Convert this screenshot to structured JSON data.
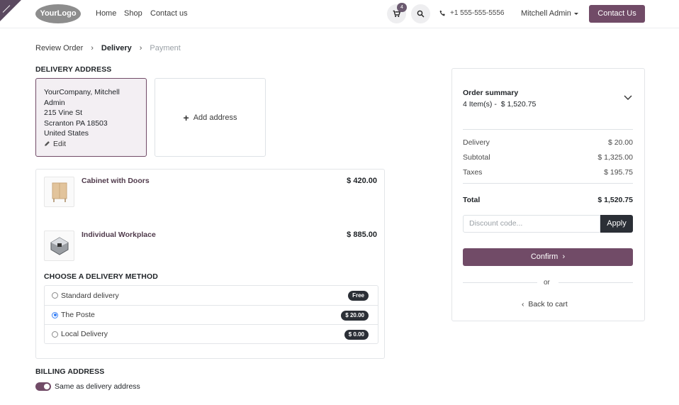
{
  "header": {
    "logo_text": "YourLogo",
    "nav": [
      "Home",
      "Shop",
      "Contact us"
    ],
    "cart_count": "4",
    "phone": "+1 555-555-5556",
    "user": "Mitchell Admin",
    "contact_button": "Contact Us"
  },
  "breadcrumb": [
    "Review Order",
    "Delivery",
    "Payment"
  ],
  "delivery_address": {
    "title": "DELIVERY ADDRESS",
    "name": "YourCompany, Mitchell Admin",
    "street": "215 Vine St",
    "city": "Scranton PA 18503",
    "country": "United States",
    "edit_label": "Edit",
    "add_label": "Add address"
  },
  "products": [
    {
      "name": "Cabinet with Doors",
      "price": "$ 420.00"
    },
    {
      "name": "Individual Workplace",
      "price": "$ 885.00"
    }
  ],
  "delivery_method": {
    "title": "CHOOSE A DELIVERY METHOD",
    "options": [
      {
        "label": "Standard delivery",
        "price": "Free",
        "selected": false
      },
      {
        "label": "The Poste",
        "price": "$ 20.00",
        "selected": true
      },
      {
        "label": "Local Delivery",
        "price": "$ 0.00",
        "selected": false
      }
    ]
  },
  "billing": {
    "title": "BILLING ADDRESS",
    "same_label": "Same as delivery address",
    "same_checked": true
  },
  "summary": {
    "title": "Order summary",
    "items": "4 Item(s) -",
    "items_total": "$ 1,520.75",
    "rows": [
      {
        "label": "Delivery",
        "value": "$ 20.00"
      },
      {
        "label": "Subtotal",
        "value": "$ 1,325.00"
      },
      {
        "label": "Taxes",
        "value": "$ 195.75"
      }
    ],
    "total_label": "Total",
    "total_value": "$ 1,520.75",
    "discount_placeholder": "Discount code...",
    "apply_label": "Apply",
    "confirm_label": "Confirm",
    "or_label": "or",
    "back_label": "Back to cart"
  },
  "colors": {
    "primary": "#714b67",
    "dark": "#2b2f36"
  }
}
